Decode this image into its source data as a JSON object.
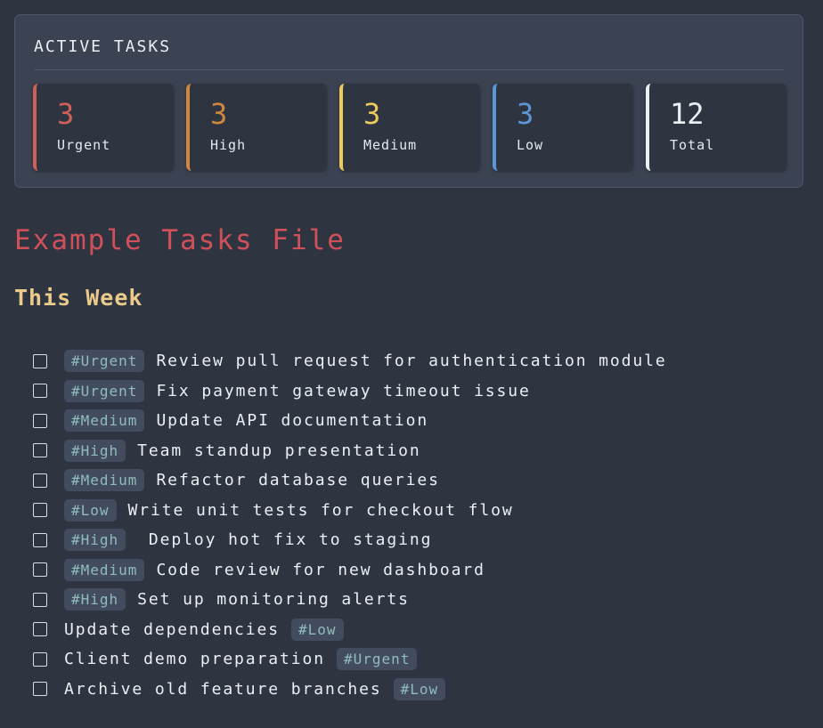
{
  "panel": {
    "title": "ACTIVE TASKS",
    "cards": [
      {
        "count": "3",
        "label": "Urgent",
        "color": "#d0605a"
      },
      {
        "count": "3",
        "label": "High",
        "color": "#d08740"
      },
      {
        "count": "3",
        "label": "Medium",
        "color": "#ebcb5b"
      },
      {
        "count": "3",
        "label": "Low",
        "color": "#5e97d8"
      },
      {
        "count": "12",
        "label": "Total",
        "color": "#eceff4"
      }
    ]
  },
  "doc": {
    "title": "Example Tasks File",
    "section": "This Week"
  },
  "tasks": [
    {
      "before": "",
      "tag": "#Urgent",
      "text": "Review pull request for authentication module",
      "checked": false
    },
    {
      "before": "",
      "tag": "#Urgent",
      "text": "Fix payment gateway timeout issue",
      "checked": false
    },
    {
      "before": "",
      "tag": "#Medium",
      "text": "Update API documentation",
      "checked": false
    },
    {
      "before": "",
      "tag": "#High",
      "text": "Team standup presentation",
      "checked": false
    },
    {
      "before": "",
      "tag": "#Medium",
      "text": "Refactor database queries",
      "checked": false
    },
    {
      "before": "",
      "tag": "#Low",
      "text": "Write unit tests for checkout flow",
      "checked": false
    },
    {
      "before": "",
      "tag": "#High",
      "text": " Deploy hot fix to staging",
      "checked": false
    },
    {
      "before": "",
      "tag": "#Medium",
      "text": "Code review for new dashboard",
      "checked": false
    },
    {
      "before": "",
      "tag": "#High",
      "text": "Set up monitoring alerts",
      "checked": false
    },
    {
      "before": "Update dependencies",
      "tag": "#Low",
      "text": "",
      "checked": false
    },
    {
      "before": "Client demo preparation",
      "tag": "#Urgent",
      "text": "",
      "checked": false
    },
    {
      "before": "Archive old feature branches",
      "tag": "#Low",
      "text": "",
      "checked": false
    }
  ]
}
